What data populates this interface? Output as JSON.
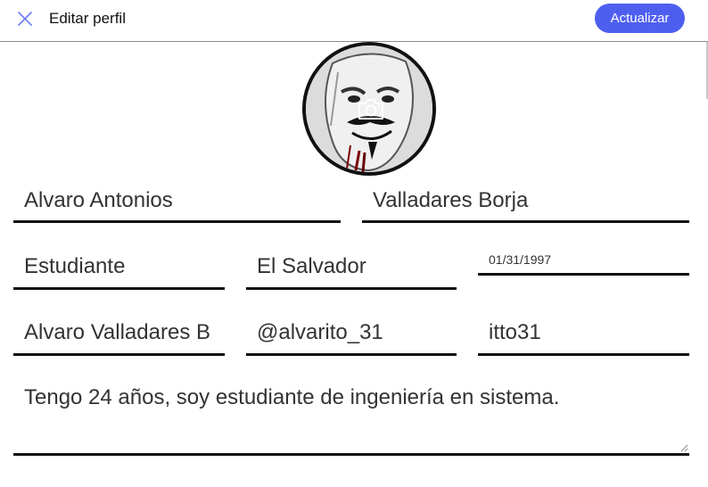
{
  "header": {
    "title": "Editar perfil",
    "update_label": "Actualizar"
  },
  "colors": {
    "accent": "#4e5ff0",
    "close_icon": "#6b7ef5"
  },
  "icons": {
    "close": "close-icon",
    "camera": "camera-icon"
  },
  "form": {
    "first_name": "Alvaro Antonios",
    "last_name": "Valladares Borja",
    "occupation": "Estudiante",
    "country": "El Salvador",
    "birth_date": "01/31/1997",
    "display_name": "Alvaro Valladares B",
    "handle": "@alvarito_31",
    "password": "itto31",
    "bio": "Tengo 24 años, soy estudiante de ingeniería en sistema."
  }
}
